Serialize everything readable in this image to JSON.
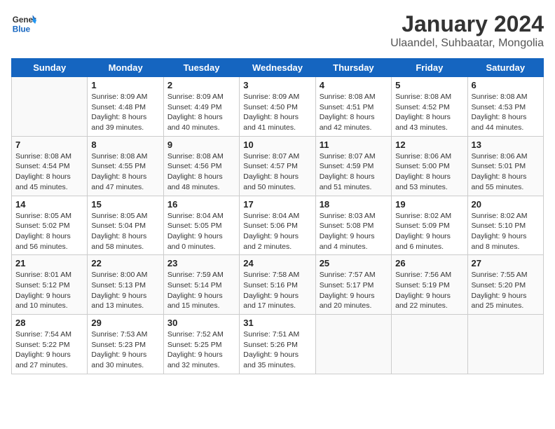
{
  "header": {
    "logo_line1": "General",
    "logo_line2": "Blue",
    "month_title": "January 2024",
    "location": "Ulaandel, Suhbaatar, Mongolia"
  },
  "days_of_week": [
    "Sunday",
    "Monday",
    "Tuesday",
    "Wednesday",
    "Thursday",
    "Friday",
    "Saturday"
  ],
  "weeks": [
    [
      {
        "day": null,
        "info": null
      },
      {
        "day": "1",
        "info": "Sunrise: 8:09 AM\nSunset: 4:48 PM\nDaylight: 8 hours\nand 39 minutes."
      },
      {
        "day": "2",
        "info": "Sunrise: 8:09 AM\nSunset: 4:49 PM\nDaylight: 8 hours\nand 40 minutes."
      },
      {
        "day": "3",
        "info": "Sunrise: 8:09 AM\nSunset: 4:50 PM\nDaylight: 8 hours\nand 41 minutes."
      },
      {
        "day": "4",
        "info": "Sunrise: 8:08 AM\nSunset: 4:51 PM\nDaylight: 8 hours\nand 42 minutes."
      },
      {
        "day": "5",
        "info": "Sunrise: 8:08 AM\nSunset: 4:52 PM\nDaylight: 8 hours\nand 43 minutes."
      },
      {
        "day": "6",
        "info": "Sunrise: 8:08 AM\nSunset: 4:53 PM\nDaylight: 8 hours\nand 44 minutes."
      }
    ],
    [
      {
        "day": "7",
        "info": "Sunrise: 8:08 AM\nSunset: 4:54 PM\nDaylight: 8 hours\nand 45 minutes."
      },
      {
        "day": "8",
        "info": "Sunrise: 8:08 AM\nSunset: 4:55 PM\nDaylight: 8 hours\nand 47 minutes."
      },
      {
        "day": "9",
        "info": "Sunrise: 8:08 AM\nSunset: 4:56 PM\nDaylight: 8 hours\nand 48 minutes."
      },
      {
        "day": "10",
        "info": "Sunrise: 8:07 AM\nSunset: 4:57 PM\nDaylight: 8 hours\nand 50 minutes."
      },
      {
        "day": "11",
        "info": "Sunrise: 8:07 AM\nSunset: 4:59 PM\nDaylight: 8 hours\nand 51 minutes."
      },
      {
        "day": "12",
        "info": "Sunrise: 8:06 AM\nSunset: 5:00 PM\nDaylight: 8 hours\nand 53 minutes."
      },
      {
        "day": "13",
        "info": "Sunrise: 8:06 AM\nSunset: 5:01 PM\nDaylight: 8 hours\nand 55 minutes."
      }
    ],
    [
      {
        "day": "14",
        "info": "Sunrise: 8:05 AM\nSunset: 5:02 PM\nDaylight: 8 hours\nand 56 minutes."
      },
      {
        "day": "15",
        "info": "Sunrise: 8:05 AM\nSunset: 5:04 PM\nDaylight: 8 hours\nand 58 minutes."
      },
      {
        "day": "16",
        "info": "Sunrise: 8:04 AM\nSunset: 5:05 PM\nDaylight: 9 hours\nand 0 minutes."
      },
      {
        "day": "17",
        "info": "Sunrise: 8:04 AM\nSunset: 5:06 PM\nDaylight: 9 hours\nand 2 minutes."
      },
      {
        "day": "18",
        "info": "Sunrise: 8:03 AM\nSunset: 5:08 PM\nDaylight: 9 hours\nand 4 minutes."
      },
      {
        "day": "19",
        "info": "Sunrise: 8:02 AM\nSunset: 5:09 PM\nDaylight: 9 hours\nand 6 minutes."
      },
      {
        "day": "20",
        "info": "Sunrise: 8:02 AM\nSunset: 5:10 PM\nDaylight: 9 hours\nand 8 minutes."
      }
    ],
    [
      {
        "day": "21",
        "info": "Sunrise: 8:01 AM\nSunset: 5:12 PM\nDaylight: 9 hours\nand 10 minutes."
      },
      {
        "day": "22",
        "info": "Sunrise: 8:00 AM\nSunset: 5:13 PM\nDaylight: 9 hours\nand 13 minutes."
      },
      {
        "day": "23",
        "info": "Sunrise: 7:59 AM\nSunset: 5:14 PM\nDaylight: 9 hours\nand 15 minutes."
      },
      {
        "day": "24",
        "info": "Sunrise: 7:58 AM\nSunset: 5:16 PM\nDaylight: 9 hours\nand 17 minutes."
      },
      {
        "day": "25",
        "info": "Sunrise: 7:57 AM\nSunset: 5:17 PM\nDaylight: 9 hours\nand 20 minutes."
      },
      {
        "day": "26",
        "info": "Sunrise: 7:56 AM\nSunset: 5:19 PM\nDaylight: 9 hours\nand 22 minutes."
      },
      {
        "day": "27",
        "info": "Sunrise: 7:55 AM\nSunset: 5:20 PM\nDaylight: 9 hours\nand 25 minutes."
      }
    ],
    [
      {
        "day": "28",
        "info": "Sunrise: 7:54 AM\nSunset: 5:22 PM\nDaylight: 9 hours\nand 27 minutes."
      },
      {
        "day": "29",
        "info": "Sunrise: 7:53 AM\nSunset: 5:23 PM\nDaylight: 9 hours\nand 30 minutes."
      },
      {
        "day": "30",
        "info": "Sunrise: 7:52 AM\nSunset: 5:25 PM\nDaylight: 9 hours\nand 32 minutes."
      },
      {
        "day": "31",
        "info": "Sunrise: 7:51 AM\nSunset: 5:26 PM\nDaylight: 9 hours\nand 35 minutes."
      },
      {
        "day": null,
        "info": null
      },
      {
        "day": null,
        "info": null
      },
      {
        "day": null,
        "info": null
      }
    ]
  ]
}
